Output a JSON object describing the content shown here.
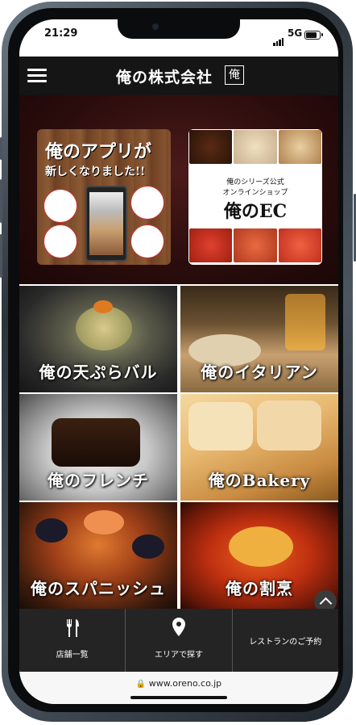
{
  "status_bar": {
    "time": "21:29",
    "network": "5G"
  },
  "header": {
    "logo": "俺の株式会社",
    "logo_mark": "俺"
  },
  "banners": [
    {
      "line1": "俺のアプリが",
      "line2": "新しくなりました!!"
    },
    {
      "line1": "俺のシリーズ公式",
      "line2": "オンラインショップ",
      "logo": "俺のEC"
    }
  ],
  "tiles": [
    {
      "label": "俺の天ぷらバル"
    },
    {
      "label": "俺のイタリアン"
    },
    {
      "label": "俺のフレンチ"
    },
    {
      "label": "俺のBakery"
    },
    {
      "label": "俺のスパニッシュ"
    },
    {
      "label": "俺の割烹"
    }
  ],
  "bottom_nav": [
    {
      "label": "店舗一覧",
      "icon": "fork-knife-icon"
    },
    {
      "label": "エリアで探す",
      "icon": "map-pin-icon"
    },
    {
      "label": "レストランのご予約",
      "icon": ""
    }
  ],
  "browser": {
    "url": "www.oreno.co.jp"
  },
  "colors": {
    "header_bg": "#151515",
    "nav_bg": "#242424",
    "banner_bg": "#2a0c0c"
  }
}
